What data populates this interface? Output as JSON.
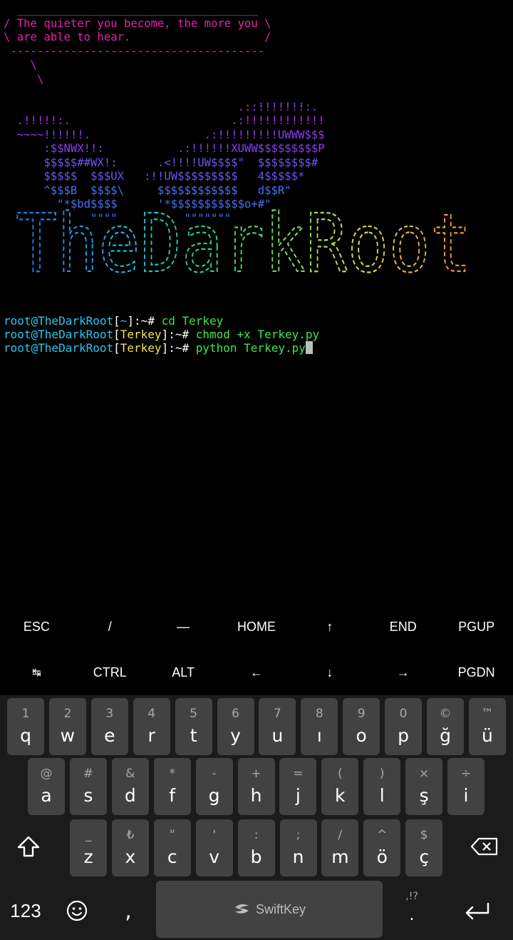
{
  "terminal": {
    "cowsay_lines": [
      "  ____________________________________",
      "/ The quieter you become, the more you \\",
      "\\ are able to hear.                    /",
      " --------------------------------------",
      "    \\",
      "     \\",
      "",
      "                                   .::!!!!!!!:.",
      "  .!!!!!:.                        .:!!!!!!!!!!!!",
      "  ~~~~!!!!!!.                 .:!!!!!!!!!UWWW$$$",
      "      :$$NWX!!:           .:!!!!!!XUWW$$$$$$$$$P",
      "      $$$$$##WX!:      .<!!!!UW$$$$\"  $$$$$$$$#",
      "      $$$$$  $$$UX   :!!UW$$$$$$$$$   4$$$$$*",
      "      ^$$$B  $$$$\\     $$$$$$$$$$$$   d$$R\"",
      "        \"*$bd$$$$      '*$$$$$$$$$$$o+#\"",
      "             \"\"\"\"          \"\"\"\"\"\"\""
    ],
    "banner_text": "TheDarkRoot",
    "commands": [
      {
        "user": "root@TheDarkRoot",
        "path": "~",
        "prompt_suffix": ":~# ",
        "command": "cd Terkey"
      },
      {
        "user": "root@TheDarkRoot",
        "path": "Terkey",
        "prompt_suffix": ":~# ",
        "command": "chmod +x Terkey.py"
      },
      {
        "user": "root@TheDarkRoot",
        "path": "Terkey",
        "prompt_suffix": ":~# ",
        "command": "python Terkey.py"
      }
    ],
    "bracket_open": "[",
    "bracket_close": "]"
  },
  "extra_keys": {
    "row1": [
      "ESC",
      "/",
      "—",
      "HOME",
      "↑",
      "END",
      "PGUP"
    ],
    "row2": [
      "↹",
      "CTRL",
      "ALT",
      "←",
      "↓",
      "→",
      "PGDN"
    ]
  },
  "keyboard": {
    "row1": [
      {
        "hint": "1",
        "key": "q"
      },
      {
        "hint": "2",
        "key": "w"
      },
      {
        "hint": "3",
        "key": "e"
      },
      {
        "hint": "4",
        "key": "r"
      },
      {
        "hint": "5",
        "key": "t"
      },
      {
        "hint": "6",
        "key": "y"
      },
      {
        "hint": "7",
        "key": "u"
      },
      {
        "hint": "8",
        "key": "ı"
      },
      {
        "hint": "9",
        "key": "o"
      },
      {
        "hint": "0",
        "key": "p"
      },
      {
        "hint": "©",
        "key": "ğ"
      },
      {
        "hint": "™",
        "key": "ü"
      }
    ],
    "row2": [
      {
        "hint": "@",
        "key": "a"
      },
      {
        "hint": "#",
        "key": "s"
      },
      {
        "hint": "&",
        "key": "d"
      },
      {
        "hint": "*",
        "key": "f"
      },
      {
        "hint": "-",
        "key": "g"
      },
      {
        "hint": "+",
        "key": "h"
      },
      {
        "hint": "=",
        "key": "j"
      },
      {
        "hint": "(",
        "key": "k"
      },
      {
        "hint": ")",
        "key": "l"
      },
      {
        "hint": "×",
        "key": "ş"
      },
      {
        "hint": "÷",
        "key": "i"
      }
    ],
    "row3": [
      {
        "hint": "_",
        "key": "z"
      },
      {
        "hint": "₺",
        "key": "x"
      },
      {
        "hint": "\"",
        "key": "c"
      },
      {
        "hint": "'",
        "key": "v"
      },
      {
        "hint": ":",
        "key": "b"
      },
      {
        "hint": ";",
        "key": "n"
      },
      {
        "hint": "/",
        "key": "m"
      },
      {
        "hint": "^",
        "key": "ö"
      },
      {
        "hint": "$",
        "key": "ç"
      }
    ],
    "numbers_label": "123",
    "comma_label": ",",
    "punct_hint": ",!?",
    "period_label": ".",
    "space_brand": "SwiftKey"
  },
  "colors": {
    "background": "#000000",
    "prompt_user": "#28c8f0",
    "path_home": "#2dc8f0",
    "path_dir": "#f4e64a",
    "command": "#3ee850",
    "keyboard_bg": "#1b1b1b",
    "key_bg": "#424242"
  },
  "icons": {
    "shift": "shift-icon",
    "backspace": "backspace-icon",
    "emoji": "emoji-icon",
    "enter": "enter-icon",
    "swiftkey_logo": "swiftkey-logo-icon"
  }
}
